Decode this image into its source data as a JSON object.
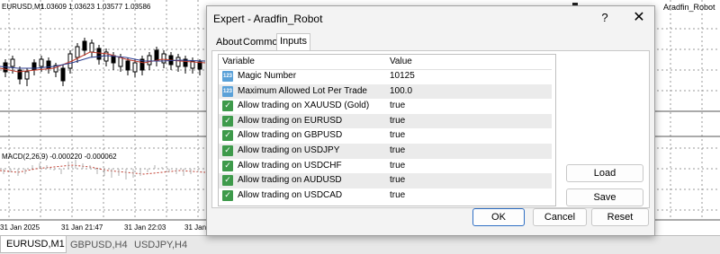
{
  "chart": {
    "symbol_label": "EURUSD,M1",
    "ohlc": "1.03609 1.03623 1.03577 1.03586",
    "macd_label": "MACD(2,26,9) -0.000220 -0.000062",
    "ea_name": "Aradfin_Robot",
    "time_labels": [
      "31 Jan 2025",
      "31 Jan 21:47",
      "31 Jan 22:03",
      "31 Jan"
    ]
  },
  "chart_tabs": [
    "EURUSD,M1",
    "GBPUSD,H4",
    "USDJPY,H4"
  ],
  "dialog": {
    "title": "Expert - Aradfin_Robot",
    "help_icon": "?",
    "close_icon": "✕",
    "tabs": [
      "About",
      "Common",
      "Inputs"
    ],
    "active_tab": "Inputs",
    "columns": {
      "variable": "Variable",
      "value": "Value"
    },
    "rows": [
      {
        "variable": "Magic Number",
        "value": "10125",
        "icon": "num"
      },
      {
        "variable": "Maximum Allowed Lot Per Trade",
        "value": "100.0",
        "icon": "num"
      },
      {
        "variable": "Allow trading on XAUUSD (Gold)",
        "value": "true",
        "icon": "bool"
      },
      {
        "variable": "Allow trading on EURUSD",
        "value": "true",
        "icon": "bool"
      },
      {
        "variable": "Allow trading on GBPUSD",
        "value": "true",
        "icon": "bool"
      },
      {
        "variable": "Allow trading on USDJPY",
        "value": "true",
        "icon": "bool"
      },
      {
        "variable": "Allow trading on USDCHF",
        "value": "true",
        "icon": "bool"
      },
      {
        "variable": "Allow trading on AUDUSD",
        "value": "true",
        "icon": "bool"
      },
      {
        "variable": "Allow trading on USDCAD",
        "value": "true",
        "icon": "bool"
      }
    ],
    "buttons": {
      "load": "Load",
      "save": "Save",
      "ok": "OK",
      "cancel": "Cancel",
      "reset": "Reset"
    }
  },
  "colors": {
    "accent": "#2f6fc4",
    "bool_icon": "#3e9a4b",
    "num_icon": "#5aa1d8"
  }
}
